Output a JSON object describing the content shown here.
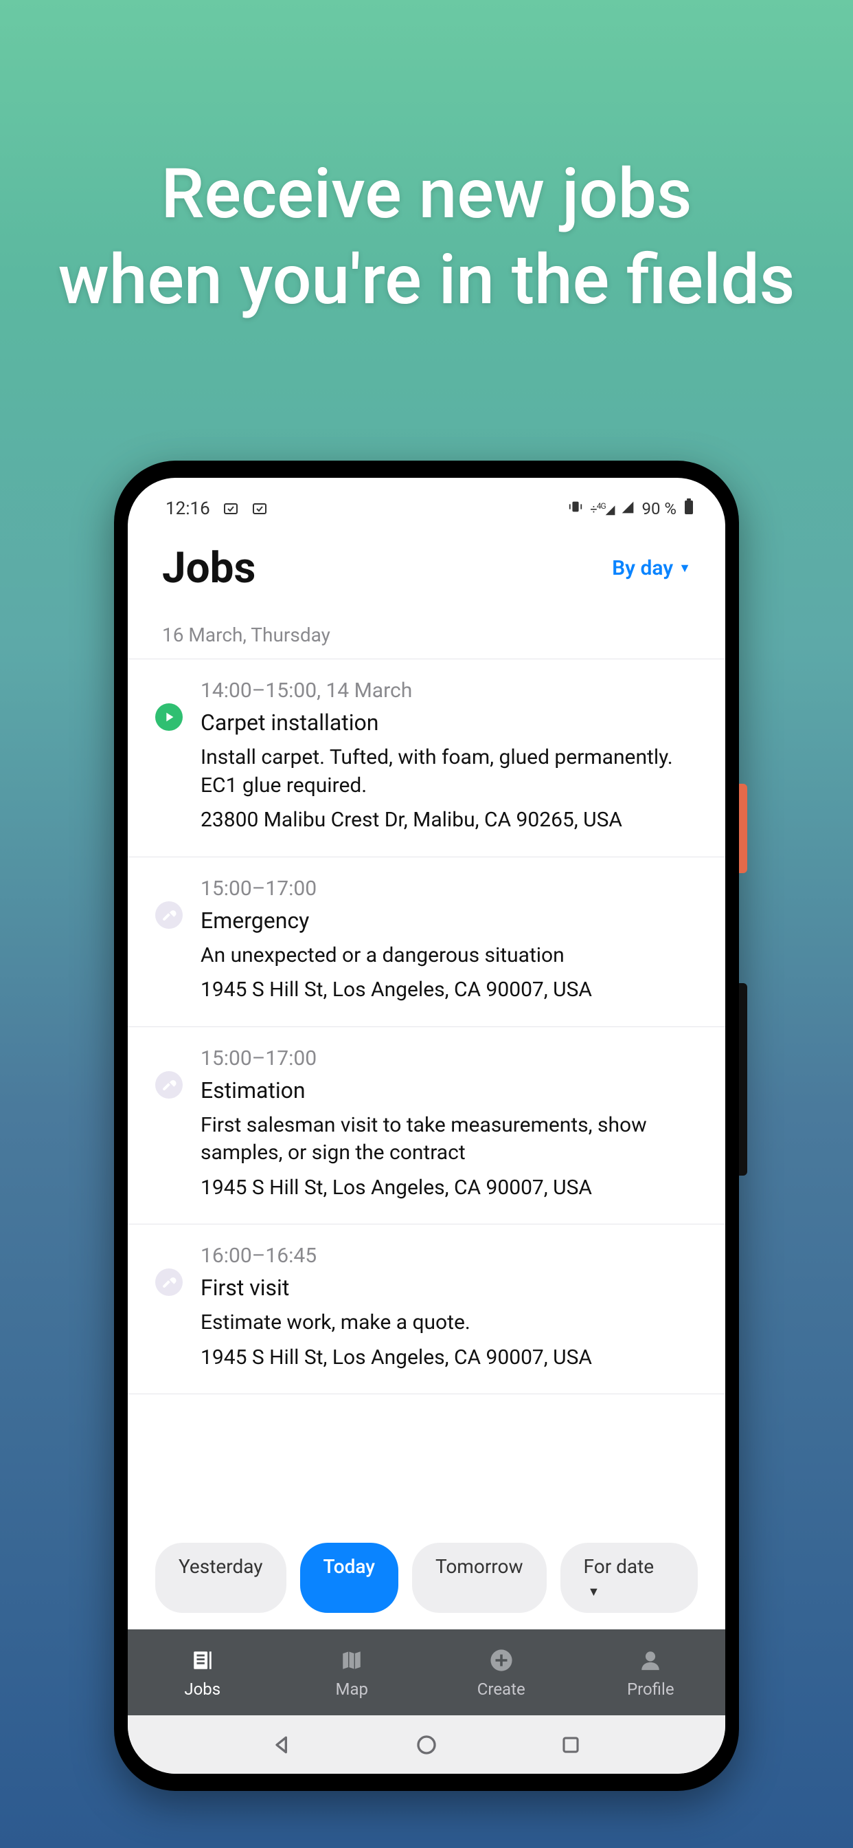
{
  "promo": {
    "line1": "Receive new jobs",
    "line2": "when you're in the fields"
  },
  "status": {
    "time": "12:16",
    "battery_pct": "90 %"
  },
  "header": {
    "title": "Jobs",
    "filter_label": "By day"
  },
  "date_label": "16 March, Thursday",
  "jobs": [
    {
      "time": "14:00–15:00, 14 March",
      "title": "Carpet installation",
      "desc": "Install carpet. Tufted, with foam, glued permanently. EC1 glue required.",
      "addr": "23800 Malibu Crest Dr, Malibu, CA 90265, USA",
      "icon": "play"
    },
    {
      "time": "15:00–17:00",
      "title": "Emergency",
      "desc": "An unexpected or a dangerous situation",
      "addr": "1945 S Hill St, Los Angeles, CA 90007, USA",
      "icon": "wrench"
    },
    {
      "time": "15:00–17:00",
      "title": "Estimation",
      "desc": "First salesman visit to take measurements, show samples, or sign the contract",
      "addr": "1945 S Hill St, Los Angeles, CA 90007, USA",
      "icon": "wrench"
    },
    {
      "time": "16:00–16:45",
      "title": "First visit",
      "desc": "Estimate work, make a quote.",
      "addr": "1945 S Hill St, Los Angeles, CA 90007, USA",
      "icon": "wrench"
    }
  ],
  "chips": {
    "yesterday": "Yesterday",
    "today": "Today",
    "tomorrow": "Tomorrow",
    "for_date": "For date"
  },
  "nav": {
    "jobs": "Jobs",
    "map": "Map",
    "create": "Create",
    "profile": "Profile"
  }
}
